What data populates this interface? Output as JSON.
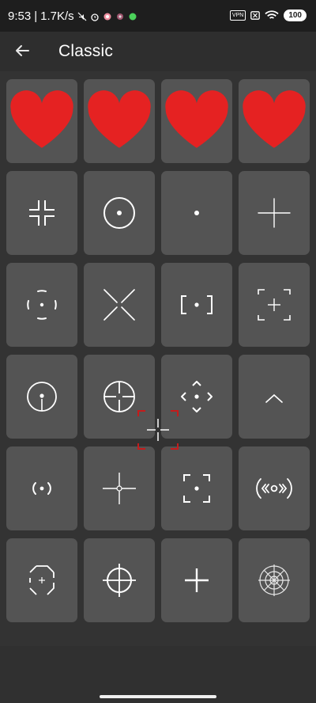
{
  "status": {
    "time": "9:53",
    "speed": "1.7K/s",
    "vpn": "VPN",
    "battery": "100"
  },
  "app_bar": {
    "title": "Classic"
  },
  "colors": {
    "favorite": "#e52222",
    "drag_preview": "#c41c1c",
    "tile": "#545454"
  },
  "crosshairs": [
    {
      "icon": "dashed-circle-dot-crosshair-icon",
      "favorite": true
    },
    {
      "icon": "plus-gap-dot-crosshair-icon",
      "favorite": true
    },
    {
      "icon": "circle-t-crosshair-icon",
      "favorite": true
    },
    {
      "icon": "x-dot-crosshair-icon",
      "favorite": true
    },
    {
      "icon": "corner-brackets-crosshair-icon",
      "favorite": false
    },
    {
      "icon": "circle-dot-crosshair-icon",
      "favorite": false
    },
    {
      "icon": "single-dot-crosshair-icon",
      "favorite": false
    },
    {
      "icon": "thin-plus-crosshair-icon",
      "favorite": false
    },
    {
      "icon": "arc-segments-dot-crosshair-icon",
      "favorite": false
    },
    {
      "icon": "large-x-crosshair-icon",
      "favorite": false
    },
    {
      "icon": "square-brackets-dot-crosshair-icon",
      "favorite": false
    },
    {
      "icon": "corner-frame-plus-crosshair-icon",
      "favorite": false
    },
    {
      "icon": "circle-stem-dot-crosshair-icon",
      "favorite": false
    },
    {
      "icon": "circle-plus-crosshair-icon",
      "favorite": false
    },
    {
      "icon": "diamond-dot-crosshair-icon",
      "favorite": false
    },
    {
      "icon": "chevron-up-crosshair-icon",
      "favorite": false
    },
    {
      "icon": "parentheses-dot-crosshair-icon",
      "favorite": false
    },
    {
      "icon": "plus-small-circle-crosshair-icon",
      "favorite": false
    },
    {
      "icon": "corner-frame-dot-crosshair-icon",
      "favorite": false
    },
    {
      "icon": "arrow-brackets-circle-crosshair-icon",
      "favorite": false
    },
    {
      "icon": "octagon-plus-crosshair-icon",
      "favorite": false
    },
    {
      "icon": "circle-long-plus-crosshair-icon",
      "favorite": false
    },
    {
      "icon": "bold-plus-crosshair-icon",
      "favorite": false
    },
    {
      "icon": "sniper-scope-crosshair-icon",
      "favorite": false
    }
  ]
}
